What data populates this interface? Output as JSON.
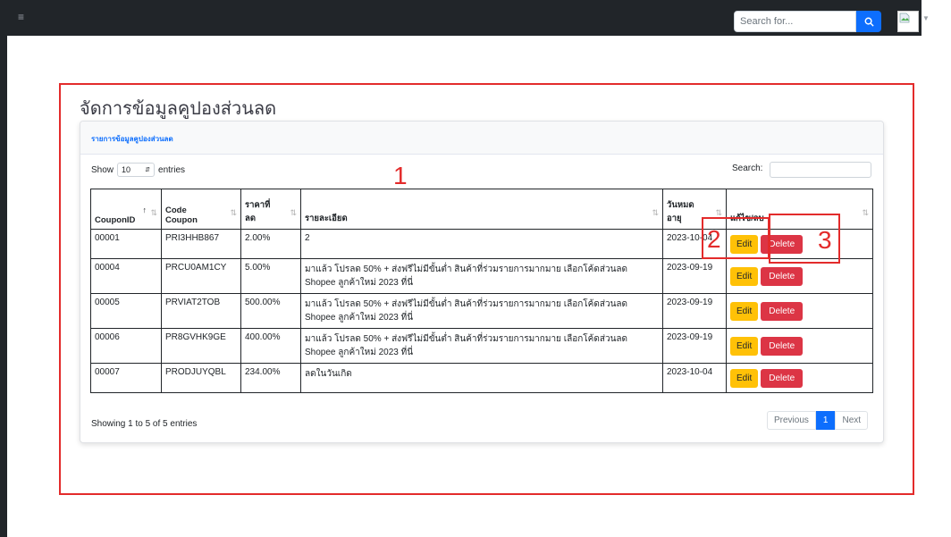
{
  "topbar": {
    "search_placeholder": "Search for...",
    "menu_icon": "hamburger-icon",
    "search_icon": "search-icon"
  },
  "page": {
    "title": "จัดการข้อมูลคูปองส่วนลด"
  },
  "card": {
    "header_title": "รายการข้อมูลคูปองส่วนลด",
    "length_prefix": "Show",
    "length_value": "10",
    "length_suffix": "entries",
    "search_label": "Search:"
  },
  "table": {
    "columns": [
      "CouponID",
      "Code Coupon",
      "ราคาที่ลด",
      "รายละเอียด",
      "วันหมดอายุ",
      "แก้ไข/ลบ"
    ],
    "rows": [
      {
        "id": "00001",
        "code": "PRI3HHB867",
        "discount": "2.00%",
        "detail": "2",
        "expiry": "2023-10-04"
      },
      {
        "id": "00004",
        "code": "PRCU0AM1CY",
        "discount": "5.00%",
        "detail": "มาแล้ว โปรลด 50% + ส่งฟรีไม่มีขั้นต่ำ สินค้าที่ร่วมรายการมากมาย เลือกโค้ดส่วนลด Shopee ลูกค้าใหม่ 2023 ที่นี่",
        "expiry": "2023-09-19"
      },
      {
        "id": "00005",
        "code": "PRVIAT2TOB",
        "discount": "500.00%",
        "detail": "มาแล้ว โปรลด 50% + ส่งฟรีไม่มีขั้นต่ำ สินค้าที่ร่วมรายการมากมาย เลือกโค้ดส่วนลด Shopee ลูกค้าใหม่ 2023 ที่นี่",
        "expiry": "2023-09-19"
      },
      {
        "id": "00006",
        "code": "PR8GVHK9GE",
        "discount": "400.00%",
        "detail": "มาแล้ว โปรลด 50% + ส่งฟรีไม่มีขั้นต่ำ สินค้าที่ร่วมรายการมากมาย เลือกโค้ดส่วนลด Shopee ลูกค้าใหม่ 2023 ที่นี่",
        "expiry": "2023-09-19"
      },
      {
        "id": "00007",
        "code": "PRODJUYQBL",
        "discount": "234.00%",
        "detail": "ลดในวันเกิด",
        "expiry": "2023-10-04"
      }
    ],
    "edit_label": "Edit",
    "delete_label": "Delete"
  },
  "footer": {
    "info": "Showing 1 to 5 of 5 entries",
    "previous": "Previous",
    "current_page": "1",
    "next": "Next"
  },
  "annotations": {
    "label_1": "1",
    "label_2": "2",
    "label_3": "3",
    "color": "#e32b2b"
  }
}
